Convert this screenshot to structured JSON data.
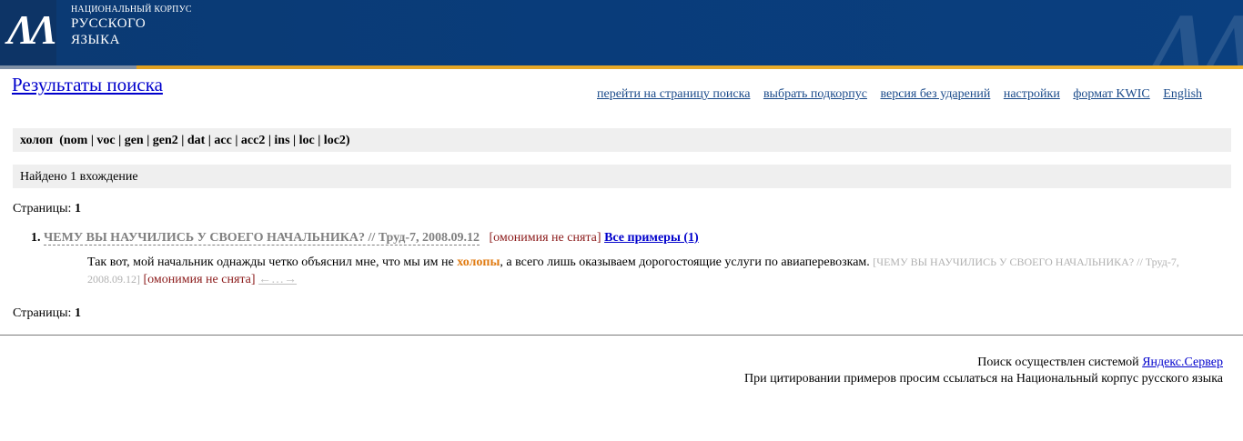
{
  "header": {
    "logo_letters": "ΛΛ",
    "logo_line1": "НАЦИОНАЛЬНЫЙ КОРПУС",
    "logo_line2": "РУССКОГО",
    "logo_line3": "ЯЗЫКА",
    "colors": {
      "header_bg": "#0b3a73",
      "stripe_left": "#7e8fa5",
      "stripe_right": "#f0b430"
    }
  },
  "page_title": "Результаты поиска",
  "topnav": [
    "перейти на страницу поиска",
    "выбрать подкорпус",
    "версия без ударений",
    "настройки",
    "формат KWIC",
    "English"
  ],
  "query": "холоп  (nom | voc | gen | gen2 | dat | acc | acc2 | ins | loc | loc2)",
  "found": "Найдено 1 вхождение",
  "pages": {
    "label": "Страницы:",
    "current": "1"
  },
  "result": {
    "number": "1.",
    "doc_title": "ЧЕМУ ВЫ НАУЧИЛИСЬ У СВОЕГО НАЧАЛЬНИКА? // Труд-7, 2008.09.12",
    "omonymy": "[омонимия не снята]",
    "all_examples": "Все примеры (1)",
    "snippet_before": "Так вот, мой начальник однажды четко объяснил мне, что мы им не ",
    "hit": "холопы",
    "snippet_after": ", а всего лишь оказываем дорогостоящие услуги по авиаперевозкам. ",
    "source": "[ЧЕМУ ВЫ НАУЧИЛИСЬ У СВОЕГО НАЧАЛЬНИКА? // Труд-7, 2008.09.12]",
    "omonymy2": "[омонимия не снята]",
    "context_arrows": "←…→"
  },
  "footer": {
    "line1_prefix": "Поиск осуществлен системой ",
    "line1_link": "Яндекс.Сервер",
    "line2": "При цитировании примеров просим ссылаться на Национальный корпус русского языка"
  }
}
